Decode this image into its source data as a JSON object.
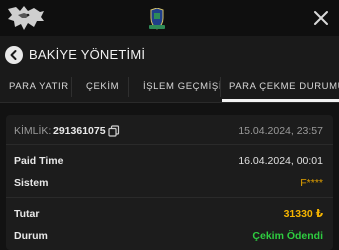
{
  "header": {
    "title": "BAKİYE YÖNETİMİ"
  },
  "tabs": [
    {
      "label": "PARA YATIR"
    },
    {
      "label": "ÇEKİM"
    },
    {
      "label": "İŞLEM GEÇMİŞİ"
    },
    {
      "label": "PARA ÇEKME DURUMU",
      "active": true
    }
  ],
  "transaction": {
    "id_label": "KİMLİK:",
    "id_value": "291361075",
    "created_at": "15.04.2024, 23:57",
    "paid_time_label": "Paid Time",
    "paid_time_value": "16.04.2024, 00:01",
    "system_label": "Sistem",
    "system_value": "F****",
    "amount_label": "Tutar",
    "amount_value": "31330 ₺",
    "status_label": "Durum",
    "status_value": "Çekim Ödendi"
  },
  "icons": {
    "logo": "wolf-logo-icon",
    "crest": "crest-icon",
    "close": "close-icon",
    "back": "chevron-left-icon",
    "copy": "copy-icon"
  },
  "colors": {
    "amount": "#f5b400",
    "status": "#2ecc40",
    "system": "#e0a000"
  }
}
